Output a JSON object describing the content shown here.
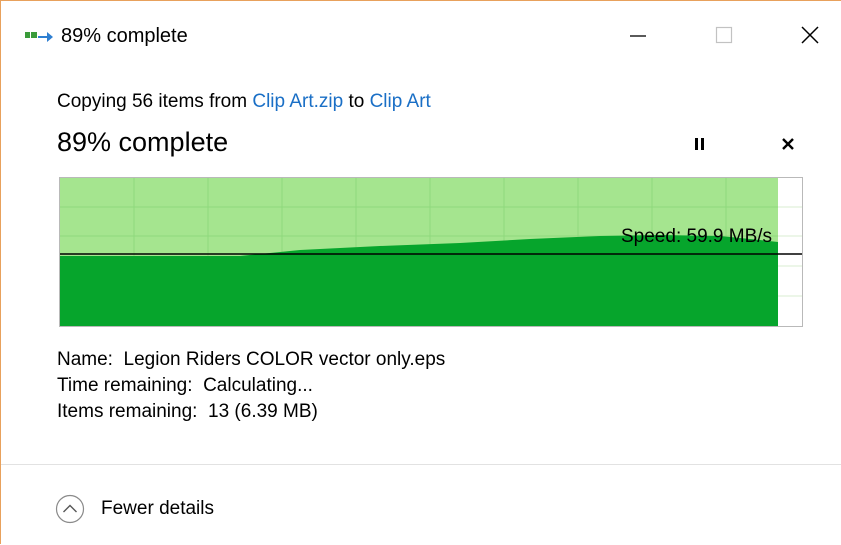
{
  "window": {
    "title": "89% complete",
    "icon": "copy-arrow-icon"
  },
  "controls": {
    "minimize_icon": "minimize-icon",
    "maximize_icon": "maximize-icon",
    "close_icon": "close-icon"
  },
  "copy": {
    "prefix": "Copying 56 items from ",
    "source": "Clip Art.zip",
    "middle": " to ",
    "destination": "Clip Art",
    "status": "89% complete",
    "progress_fraction": 0.89
  },
  "actions": {
    "pause_icon": "pause-icon",
    "cancel_icon": "cancel-icon"
  },
  "graph": {
    "speed_text": "Speed: 59.9 MB/s",
    "colors": {
      "remaining": "#a5e58f",
      "done": "#06a52c",
      "grid": "#8fd97c",
      "line": "#000000"
    }
  },
  "details": {
    "name_label": "Name:",
    "name_value": "Legion Riders COLOR vector only.eps",
    "time_label": "Time remaining:",
    "time_value": "Calculating...",
    "items_label": "Items remaining:",
    "items_value": "13 (6.39 MB)"
  },
  "footer": {
    "toggle_label": "Fewer details",
    "toggle_icon": "chevron-up-circle-icon"
  }
}
